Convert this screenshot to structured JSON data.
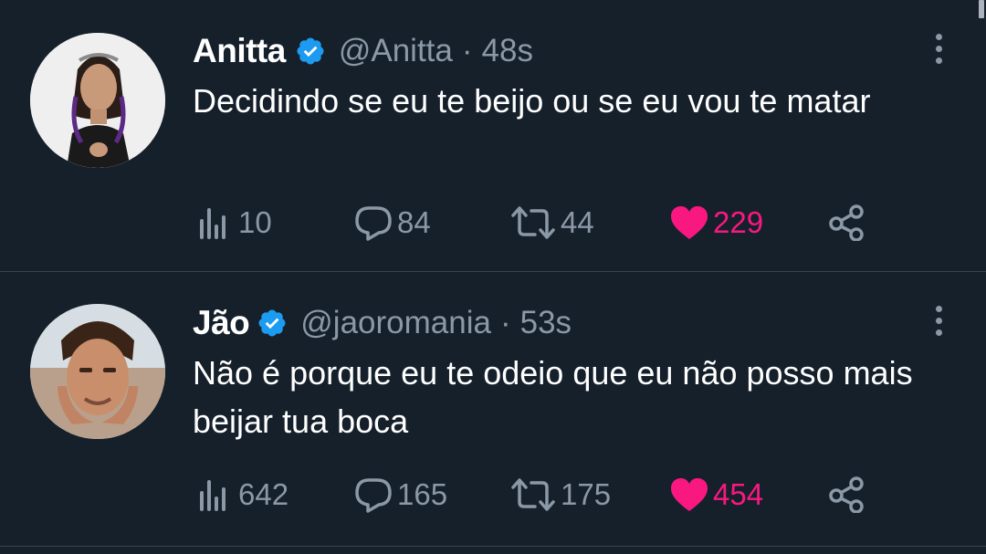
{
  "tweets": [
    {
      "name": "Anitta",
      "handle": "@Anitta",
      "separator": "·",
      "time": "48s",
      "text": "Decidindo se eu te beijo ou se eu vou te matar",
      "views": "10",
      "replies": "84",
      "retweets": "44",
      "likes": "229",
      "liked": true
    },
    {
      "name": "Jão",
      "handle": "@jaoromania",
      "separator": "·",
      "time": "53s",
      "text": "Não é porque eu te odeio que eu não posso mais beijar tua boca",
      "views": "642",
      "replies": "165",
      "retweets": "175",
      "likes": "454",
      "liked": true
    }
  ],
  "colors": {
    "background": "#15202b",
    "text": "#ffffff",
    "muted": "#8b98a5",
    "like": "#f91880",
    "verified": "#1d9bf0",
    "divider": "#38444d"
  },
  "icons": {
    "verified": "verified-badge-icon",
    "more": "more-vertical-icon",
    "views": "bar-chart-icon",
    "reply": "speech-bubble-icon",
    "retweet": "retweet-icon",
    "like": "heart-icon",
    "share": "share-icon"
  }
}
